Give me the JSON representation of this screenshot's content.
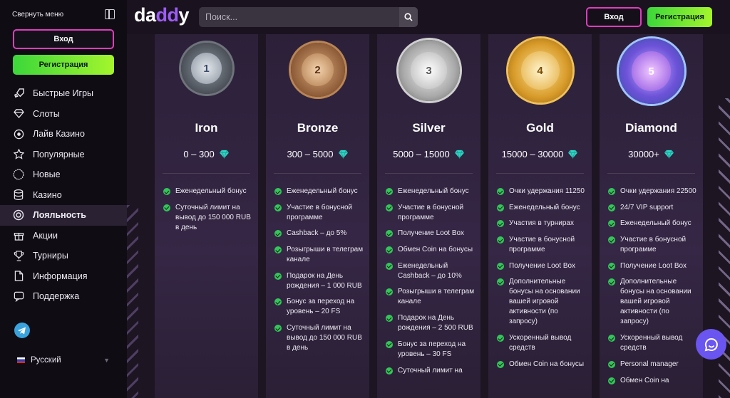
{
  "sidebar": {
    "collapse_label": "Свернуть меню",
    "login_label": "Вход",
    "register_label": "Регистрация",
    "items": [
      {
        "label": "Быстрые Игры",
        "icon": "rocket-icon"
      },
      {
        "label": "Слоты",
        "icon": "diamond-icon"
      },
      {
        "label": "Лайв Казино",
        "icon": "live-icon"
      },
      {
        "label": "Популярные",
        "icon": "star-icon"
      },
      {
        "label": "Новые",
        "icon": "new-icon"
      },
      {
        "label": "Казино",
        "icon": "database-icon"
      },
      {
        "label": "Лояльность",
        "icon": "medal-icon",
        "active": true
      },
      {
        "label": "Акции",
        "icon": "gift-icon"
      },
      {
        "label": "Турниры",
        "icon": "trophy-icon"
      },
      {
        "label": "Информация",
        "icon": "document-icon"
      },
      {
        "label": "Поддержка",
        "icon": "support-icon"
      }
    ],
    "language": "Русский"
  },
  "header": {
    "logo_prefix": "da",
    "logo_accent": "dd",
    "logo_suffix": "y",
    "search_placeholder": "Поиск...",
    "login_label": "Вход",
    "register_label": "Регистрация"
  },
  "colors": {
    "accent_pink": "#e03cbf",
    "accent_green": "#3bd73a",
    "check_green": "#34c55a",
    "gem_cyan": "#2ed3c4",
    "chat_purple": "#6b55f0"
  },
  "tiers": [
    {
      "name": "Iron",
      "range": "0 – 300",
      "level": "1",
      "features": [
        "Еженедельный бонус",
        "Суточный лимит на вывод до 150 000 RUB в день"
      ]
    },
    {
      "name": "Bronze",
      "range": "300 – 5000",
      "level": "2",
      "features": [
        "Еженедельный бонус",
        "Участие в бонусной программе",
        "Cashback – до 5%",
        "Розыгрыши в телеграм канале",
        "Подарок на День рождения – 1 000 RUB",
        "Бонус за переход на уровень – 20 FS",
        "Суточный лимит на вывод до 150 000 RUB в день"
      ]
    },
    {
      "name": "Silver",
      "range": "5000 – 15000",
      "level": "3",
      "features": [
        "Еженедельный бонус",
        "Участие в бонусной программе",
        "Получение Loot Box",
        "Обмен Coin на бонусы",
        "Еженедельный Cashback – до 10%",
        "Розыгрыши в телеграм канале",
        "Подарок на День рождения – 2 500 RUB",
        "Бонус за переход на уровень – 30 FS",
        "Суточный лимит на"
      ]
    },
    {
      "name": "Gold",
      "range": "15000 – 30000",
      "level": "4",
      "features": [
        "Очки удержания 11250",
        "Еженедельный бонус",
        "Участия в турнирах",
        "Участие в бонусной программе",
        "Получение Loot Box",
        "Дополнительные бонусы на основании вашей игровой активности (по запросу)",
        "Ускоренный вывод средств",
        "Обмен Coin на бонусы"
      ]
    },
    {
      "name": "Diamond",
      "range": "30000+",
      "level": "5",
      "features": [
        "Очки удержания 22500",
        "24/7 VIP support",
        "Еженедельный бонус",
        "Участие в бонусной программе",
        "Получение Loot Box",
        "Дополнительные бонусы на основании вашей игровой активности (по запросу)",
        "Ускоренный вывод средств",
        "Personal manager",
        "Обмен Coin на"
      ]
    }
  ]
}
